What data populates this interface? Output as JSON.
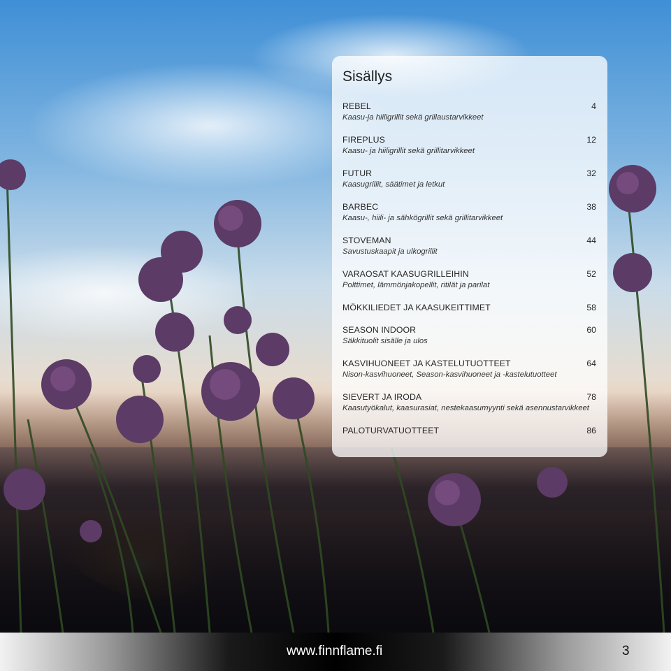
{
  "toc": {
    "title": "Sisällys",
    "entries": [
      {
        "name": "REBEL",
        "page": "4",
        "subtitle": "Kaasu-ja hiiligrillit sekä grillaustarvikkeet"
      },
      {
        "name": "FIREPLUS",
        "page": "12",
        "subtitle": "Kaasu- ja hiiligrillit sekä grillitarvikkeet"
      },
      {
        "name": "FUTUR",
        "page": "32",
        "subtitle": "Kaasugrillit, säätimet ja letkut"
      },
      {
        "name": "BARBEC",
        "page": "38",
        "subtitle": "Kaasu-, hiili- ja sähkögrillit sekä grillitarvikkeet"
      },
      {
        "name": "STOVEMAN",
        "page": "44",
        "subtitle": "Savustuskaapit ja ulkogrillit"
      },
      {
        "name": "VARAOSAT KAASUGRILLEIHIN",
        "page": "52",
        "subtitle": "Polttimet, lämmönjakopellit, ritilät ja parilat"
      },
      {
        "name": "MÖKKILIEDET JA KAASUKEITTIMET",
        "page": "58",
        "subtitle": ""
      },
      {
        "name": "SEASON INDOOR",
        "page": "60",
        "subtitle": "Säkkituolit sisälle ja ulos"
      },
      {
        "name": "KASVIHUONEET JA KASTELUTUOTTEET",
        "page": "64",
        "subtitle": "Nison-kasvihuoneet, Season-kasvihuoneet ja -kastelutuotteet"
      },
      {
        "name": "SIEVERT JA IRODA",
        "page": "78",
        "subtitle": "Kaasutyökalut, kaasurasiat, nestekaasumyynti sekä asennustarvikkeet"
      },
      {
        "name": "PALOTURVATUOTTEET",
        "page": "86",
        "subtitle": ""
      }
    ]
  },
  "footer": {
    "url": "www.finnflame.fi",
    "page_number": "3"
  }
}
